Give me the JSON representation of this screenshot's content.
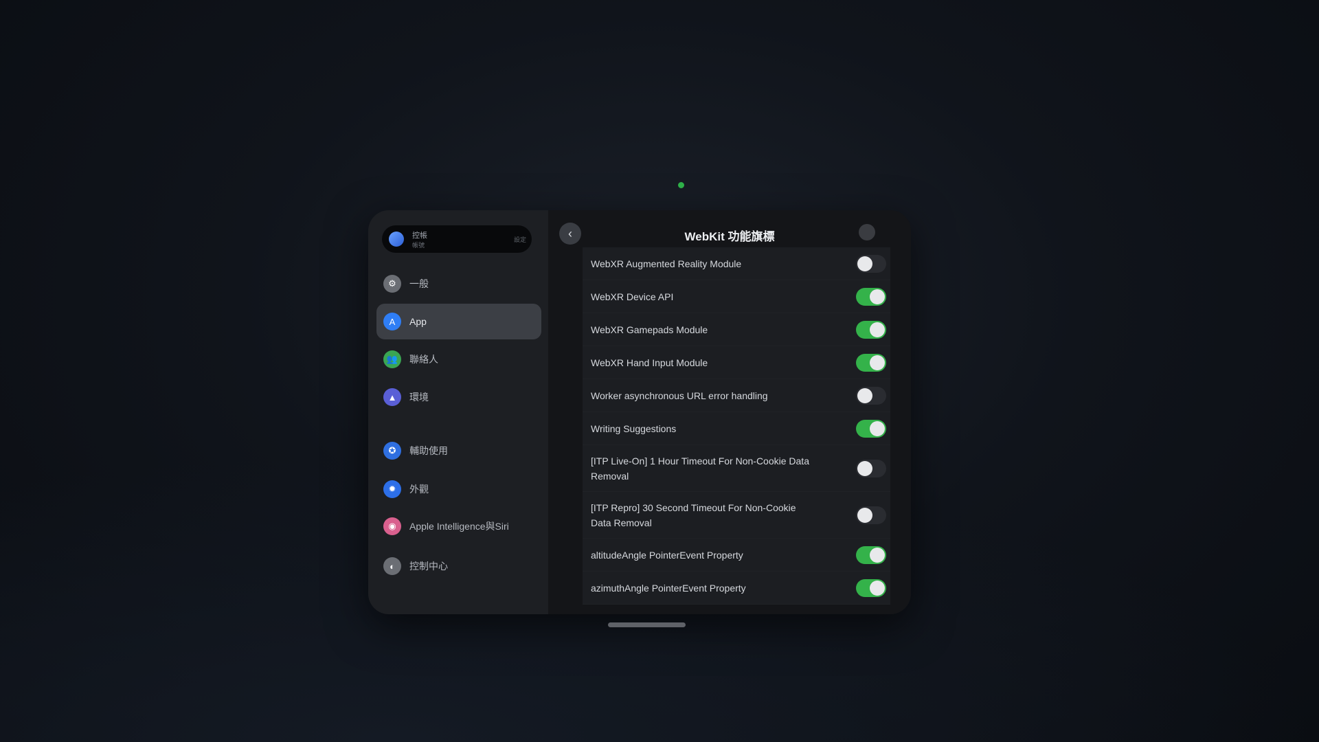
{
  "account": {
    "name": "控帳",
    "sub": "帳號",
    "side": "設定"
  },
  "sidebar": {
    "items": [
      {
        "label": "一般",
        "icon": "gear-icon",
        "color": "#6b6e74"
      },
      {
        "label": "App",
        "icon": "app-store-icon",
        "color": "#2f7ef5",
        "active": true
      },
      {
        "label": "聯絡人",
        "icon": "people-icon",
        "color": "#3aa653"
      },
      {
        "label": "環境",
        "icon": "mountain-icon",
        "color": "#5a5fd6"
      },
      {
        "label": "輔助使用",
        "icon": "accessibility-icon",
        "color": "#2f6fe0"
      },
      {
        "label": "外觀",
        "icon": "sun-icon",
        "color": "#2d6fe8"
      },
      {
        "label": "Apple Intelligence與Siri",
        "icon": "siri-icon",
        "color": "#d9608e"
      },
      {
        "label": "控制中心",
        "icon": "control-center-icon",
        "color": "#6b6e74"
      }
    ]
  },
  "detail": {
    "back_icon": "chevron-left-icon",
    "title": "WebKit 功能旗標",
    "rows": [
      {
        "label": "WebXR Augmented Reality Module",
        "on": false
      },
      {
        "label": "WebXR Device API",
        "on": true
      },
      {
        "label": "WebXR Gamepads Module",
        "on": true
      },
      {
        "label": "WebXR Hand Input Module",
        "on": true
      },
      {
        "label": "Worker asynchronous URL error handling",
        "on": false
      },
      {
        "label": "Writing Suggestions",
        "on": true
      },
      {
        "label": "[ITP Live-On] 1 Hour Timeout For Non-Cookie Data Removal",
        "on": false,
        "tall": true
      },
      {
        "label": "[ITP Repro] 30 Second Timeout For Non-Cookie Data Removal",
        "on": false,
        "tall": true
      },
      {
        "label": "altitudeAngle PointerEvent Property",
        "on": true
      },
      {
        "label": "azimuthAngle PointerEvent Property",
        "on": true
      }
    ]
  },
  "colors": {
    "toggle_on": "#34b24a",
    "accent": "#2f7ef5"
  }
}
